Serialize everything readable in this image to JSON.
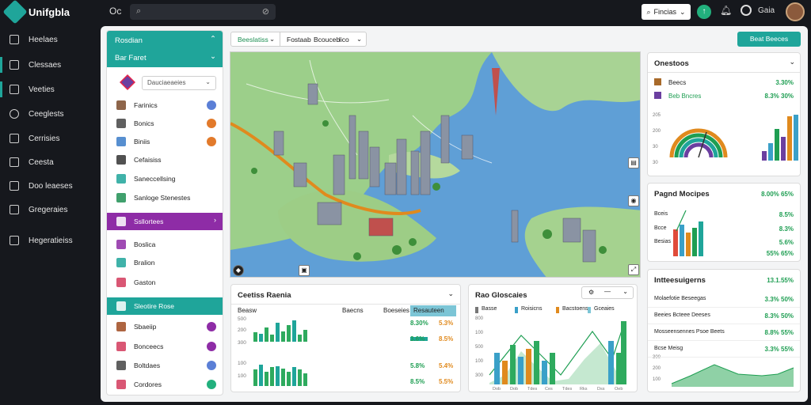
{
  "topbar": {
    "app_title": "Unifgbla",
    "mini_label": "Oc",
    "filter_label": "Fincias",
    "user_label": "Gaia"
  },
  "rail": [
    "Heelaes",
    "Clessaes",
    "Veeties",
    "Ceeglests",
    "Cerrisies",
    "Ceesta",
    "Doo leaeses",
    "Gregeraies",
    "Hegeratieiss"
  ],
  "left_panel": {
    "header_title": "Rosdian",
    "header_sub": "Bar Faret",
    "search_placeholder": "Dauciaeaeies",
    "items": [
      {
        "label": "Farinics",
        "icon_color": "#7a4a2a",
        "dot_color": "#5b7fd6"
      },
      {
        "label": "Bonics",
        "icon_color": "#444",
        "dot_color": "#e27a2b"
      },
      {
        "label": "Biniis",
        "icon_color": "#3a7bc8",
        "dot_color": "#e27a2b"
      },
      {
        "label": "Cefaisiss",
        "icon_color": "#333",
        "dot_color": ""
      },
      {
        "label": "Saneccellsing",
        "icon_color": "#1fa59a",
        "dot_color": ""
      },
      {
        "label": "Sanloge Stenestes",
        "icon_color": "#1e8f54",
        "dot_color": ""
      },
      {
        "label": "Ssllortees",
        "icon_color": "#fff",
        "dot_color": ""
      },
      {
        "label": "Boslica",
        "icon_color": "#8e2ca6",
        "dot_color": ""
      },
      {
        "label": "Bralion",
        "icon_color": "#1fa59a",
        "dot_color": ""
      },
      {
        "label": "Gaston",
        "icon_color": "#d23a5c",
        "dot_color": ""
      },
      {
        "label": "Sleotire Rose",
        "icon_color": "#fff",
        "dot_color": ""
      },
      {
        "label": "Sbaeiip",
        "icon_color": "#a04a20",
        "dot_color": "#8e2ca6"
      },
      {
        "label": "Bonceecs",
        "icon_color": "#d23a5c",
        "dot_color": "#8e2ca6"
      },
      {
        "label": "Boltdaes",
        "icon_color": "#444",
        "dot_color": "#5b7fd6"
      },
      {
        "label": "Cordores",
        "icon_color": "#d23a5c",
        "dot_color": "#22b07d"
      }
    ]
  },
  "toolbar": {
    "left_a": "Beeslatiss",
    "left_b": "Fostaab",
    "left_c": "Bcouceb",
    "left_d": "lico",
    "export_label": "Beat Beeces"
  },
  "bottom_left": {
    "title": "Ceetiss Raenia",
    "headers": [
      "Beasw",
      "Baecns",
      "Boeseies",
      "Resauteen"
    ],
    "rows": [
      {
        "v1": "8.30%",
        "v2": "5.3%"
      },
      {
        "v1": "3.6%",
        "v2": "8.5%"
      },
      {
        "v1": "5.8%",
        "v2": "5.4%"
      },
      {
        "v1": "8.5%",
        "v2": "5.5%"
      }
    ],
    "y_ticks": [
      "500",
      "200",
      "300",
      "100",
      "100"
    ]
  },
  "bottom_mid": {
    "title": "Rao Gloscaies",
    "legend": [
      "Basse",
      "Roisicns",
      "Bacstoens",
      "Gceaies"
    ],
    "y_ticks": [
      "800",
      "100",
      "500",
      "100",
      "300"
    ],
    "x_ticks": [
      "Dob",
      "Dob",
      "Tdes",
      "Ces",
      "Tdes",
      "Rks",
      "Dss",
      "Oeb"
    ]
  },
  "right_top": {
    "title": "Onestoos",
    "rows": [
      {
        "label": "Beecs",
        "value": "3.30%"
      },
      {
        "label": "Beb Bncres",
        "value": "8.3% 30%"
      }
    ],
    "y_ticks": [
      "205",
      "200",
      "30",
      "30"
    ]
  },
  "right_mid": {
    "title": "Pagnd Mocipes",
    "title_value": "8.00% 65%",
    "rows": [
      {
        "label": "Bceis",
        "value": "8.5%"
      },
      {
        "label": "Bcce",
        "value": "8.3%"
      },
      {
        "label": "Besias",
        "value": "5.6%"
      },
      {
        "label": "",
        "value": "55% 65%"
      }
    ]
  },
  "right_bot": {
    "title": "Intteesuigerns",
    "title_value": "13.1.55%",
    "rows": [
      {
        "label": "Molaefotie Beseegas",
        "value": "3.3% 50%"
      },
      {
        "label": "Beeies Bcteee Deeses",
        "value": "8.3% 50%"
      },
      {
        "label": "Mosseensennes Psoe Beets",
        "value": "8.8% 55%"
      },
      {
        "label": "Bcse Meisg",
        "value": "3.3% 55%"
      }
    ],
    "y_ticks": [
      "300",
      "200",
      "100"
    ]
  },
  "colors": {
    "teal": "#1fa59a",
    "purple": "#8e2ca6",
    "green": "#1e9e52",
    "orange": "#e08a1e",
    "dark": "#16181d"
  }
}
